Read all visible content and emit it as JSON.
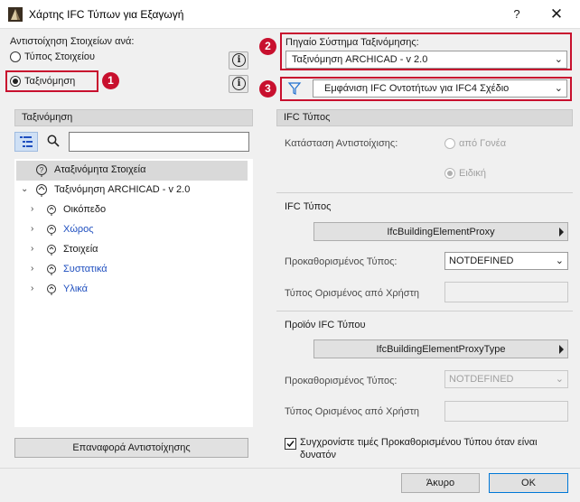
{
  "window": {
    "title": "Χάρτης IFC Τύπων για Εξαγωγή",
    "help": "?",
    "close": "✕"
  },
  "left": {
    "mapping_label": "Αντιστοίχηση Στοιχείων ανά:",
    "radio_element_type": "Τύπος Στοιχείου",
    "radio_classification": "Ταξινόμηση",
    "badge1": "1",
    "panel_title": "Ταξινόμηση",
    "search_value": "",
    "tree": [
      {
        "label": "Αταξινόμητα Στοιχεία",
        "color": "#1a1a1a"
      },
      {
        "label": "Ταξινόμηση ARCHICAD - v 2.0",
        "color": "#1a1a1a"
      },
      {
        "label": "Οικόπεδο",
        "color": "#1a1a1a"
      },
      {
        "label": "Χώρος",
        "color": "#1f4fbf"
      },
      {
        "label": "Στοιχεία",
        "color": "#1a1a1a"
      },
      {
        "label": "Συστατικά",
        "color": "#1f4fbf"
      },
      {
        "label": "Υλικά",
        "color": "#1f4fbf"
      }
    ],
    "reset_button": "Επαναφορά Αντιστοίχησης"
  },
  "right": {
    "badge2": "2",
    "badge3": "3",
    "source_label": "Πηγαίο Σύστημα Ταξινόμησης:",
    "source_value": "Ταξινόμηση ARCHICAD - v 2.0",
    "filter_value": "Εμφάνιση IFC Οντοτήτων για IFC4 Σχέδιο",
    "ifc_type_header": "IFC Τύπος",
    "mapping_state_label": "Κατάσταση Αντιστοίχισης:",
    "from_parent": "από Γονέα",
    "custom": "Ειδική",
    "ifc_type_label": "IFC Τύπος",
    "ifc_type_value": "IfcBuildingElementProxy",
    "predefined_label": "Προκαθορισμένος Τύπος:",
    "predefined_value": "NOTDEFINED",
    "user_defined_label": "Τύπος Ορισμένος από Χρήστη",
    "user_defined_value": "",
    "product_type_label": "Προϊόν IFC Τύπου",
    "product_type_value": "IfcBuildingElementProxyType",
    "predefined2_label": "Προκαθορισμένος Τύπος:",
    "predefined2_value": "NOTDEFINED",
    "user_defined2_label": "Τύπος Ορισμένος από Χρήστη",
    "user_defined2_value": "",
    "sync_label_line1": "Συγχρονίστε τιμές Προκαθορισμένου Τύπου όταν είναι",
    "sync_label_line2": "δυνατόν",
    "sync_checked": true
  },
  "footer": {
    "cancel": "Άκυρο",
    "ok": "OK"
  },
  "colors": {
    "accent_red": "#c8102e",
    "link_blue": "#1f4fbf"
  }
}
